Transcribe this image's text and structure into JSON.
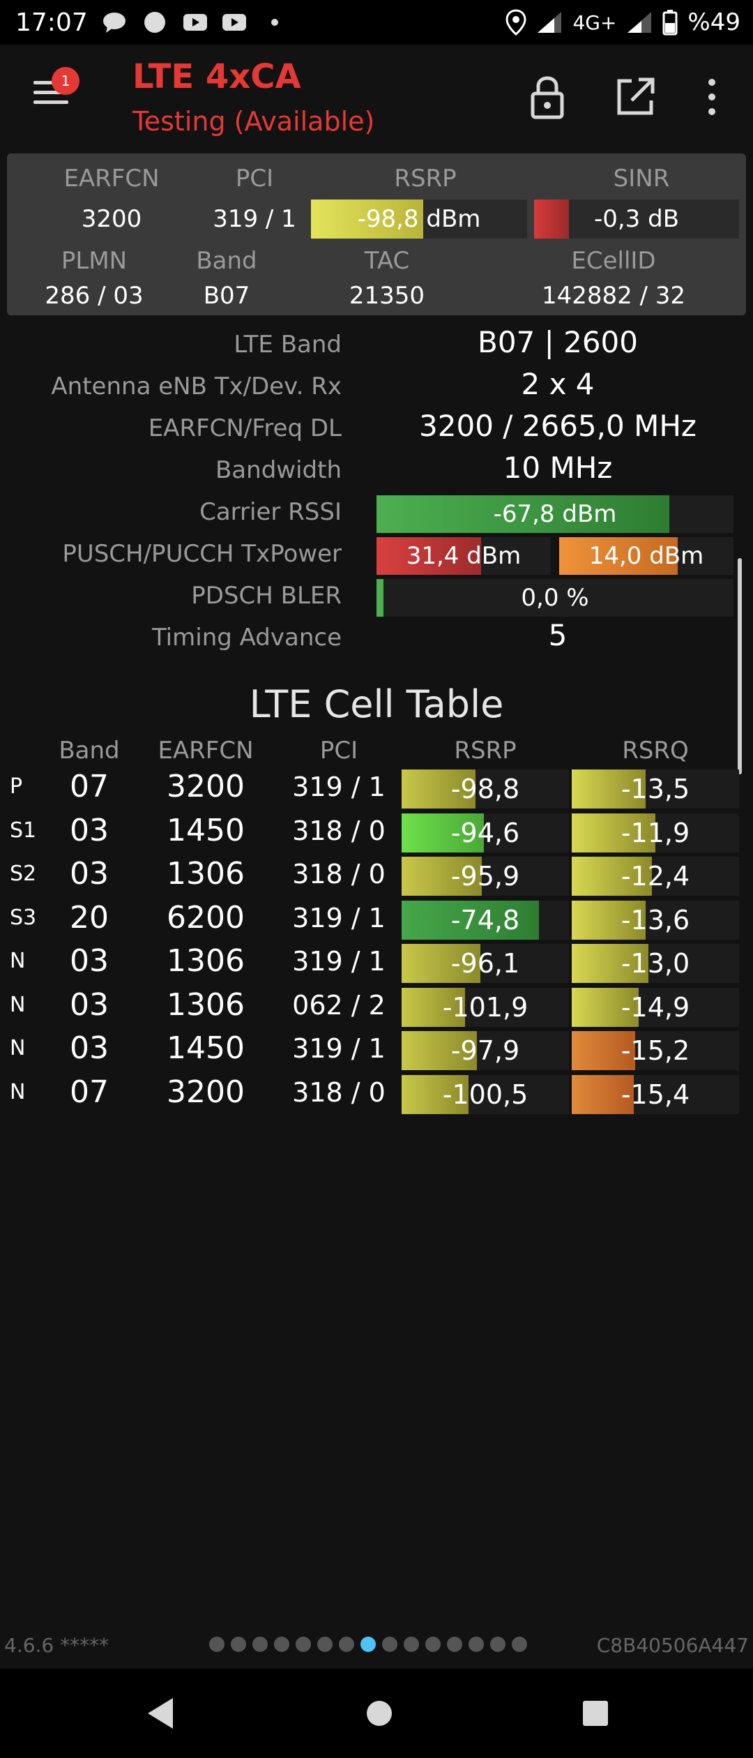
{
  "status": {
    "time": "17:07",
    "network": "4G+",
    "battery": "%49"
  },
  "app": {
    "title": "LTE 4xCA",
    "subtitle": "Testing (Available)",
    "badge": "1"
  },
  "summary": {
    "h_earfcn": "EARFCN",
    "h_pci": "PCI",
    "h_rsrp": "RSRP",
    "h_sinr": "SINR",
    "earfcn": "3200",
    "pci": "319 / 1",
    "rsrp": "-98,8 dBm",
    "rsrp_level": 0.52,
    "sinr": "-0,3 dB",
    "sinr_level": 0.17,
    "h_plmn": "PLMN",
    "h_band": "Band",
    "h_tac": "TAC",
    "h_ecellid": "ECellID",
    "plmn": "286 / 03",
    "band": "B07",
    "tac": "21350",
    "ecellid": "142882 / 32"
  },
  "details": {
    "lte_band_label": "LTE Band",
    "lte_band": "B07 | 2600",
    "antenna_label": "Antenna eNB Tx/Dev. Rx",
    "antenna": "2 x 4",
    "freq_label": "EARFCN/Freq DL",
    "freq": "3200 / 2665,0 MHz",
    "bandwidth_label": "Bandwidth",
    "bandwidth": "10 MHz",
    "rssi_label": "Carrier RSSI",
    "rssi": "-67,8 dBm",
    "rssi_level": 0.82,
    "txpower_label": "PUSCH/PUCCH TxPower",
    "pusch": "31,4 dBm",
    "pusch_level": 0.6,
    "pucch": "14,0 dBm",
    "pucch_level": 0.68,
    "bler_label": "PDSCH BLER",
    "bler": "0,0 %",
    "bler_level": 0.02,
    "ta_label": "Timing Advance",
    "ta": "5"
  },
  "cell_table": {
    "title": "LTE Cell Table",
    "headers": {
      "band": "Band",
      "earfcn": "EARFCN",
      "pci": "PCI",
      "rsrp": "RSRP",
      "rsrq": "RSRQ"
    },
    "rows": [
      {
        "type": "P",
        "band": "07",
        "earfcn": "3200",
        "pci": "319 / 1",
        "rsrp": "-98,8",
        "rsrp_level": 0.44,
        "rsrp_color": "#c8c84a",
        "rsrq": "-13,5",
        "rsrq_level": 0.44,
        "rsrq_color": "#c8c84a"
      },
      {
        "type": "S1",
        "band": "03",
        "earfcn": "1450",
        "pci": "318 / 0",
        "rsrp": "-94,6",
        "rsrp_level": 0.49,
        "rsrp_color": "#62d04a",
        "rsrq": "-11,9",
        "rsrq_level": 0.5,
        "rsrq_color": "#c8c84a"
      },
      {
        "type": "S2",
        "band": "03",
        "earfcn": "1306",
        "pci": "318 / 0",
        "rsrp": "-95,9",
        "rsrp_level": 0.48,
        "rsrp_color": "#c8c84a",
        "rsrq": "-12,4",
        "rsrq_level": 0.48,
        "rsrq_color": "#c8c84a"
      },
      {
        "type": "S3",
        "band": "20",
        "earfcn": "6200",
        "pci": "319 / 1",
        "rsrp": "-74,8",
        "rsrp_level": 0.82,
        "rsrp_color": "#3f9e44",
        "rsrq": "-13,6",
        "rsrq_level": 0.44,
        "rsrq_color": "#c8c84a"
      },
      {
        "type": "N",
        "band": "03",
        "earfcn": "1306",
        "pci": "319 / 1",
        "rsrp": "-96,1",
        "rsrp_level": 0.47,
        "rsrp_color": "#c8c84a",
        "rsrq": "-13,0",
        "rsrq_level": 0.46,
        "rsrq_color": "#c8c84a"
      },
      {
        "type": "N",
        "band": "03",
        "earfcn": "1306",
        "pci": "062 / 2",
        "rsrp": "-101,9",
        "rsrp_level": 0.38,
        "rsrp_color": "#c8c84a",
        "rsrq": "-14,9",
        "rsrq_level": 0.4,
        "rsrq_color": "#c8c84a"
      },
      {
        "type": "N",
        "band": "03",
        "earfcn": "1450",
        "pci": "319 / 1",
        "rsrp": "-97,9",
        "rsrp_level": 0.45,
        "rsrp_color": "#c8c84a",
        "rsrq": "-15,2",
        "rsrq_level": 0.38,
        "rsrq_color": "#d9782e"
      },
      {
        "type": "N",
        "band": "07",
        "earfcn": "3200",
        "pci": "318 / 0",
        "rsrp": "-100,5",
        "rsrp_level": 0.4,
        "rsrp_color": "#c8c84a",
        "rsrq": "-15,4",
        "rsrq_level": 0.37,
        "rsrq_color": "#d9782e"
      }
    ]
  },
  "footer": {
    "version": "4.6.6 *****",
    "device_id": "C8B40506A447",
    "pages": 15,
    "active_page": 7
  }
}
